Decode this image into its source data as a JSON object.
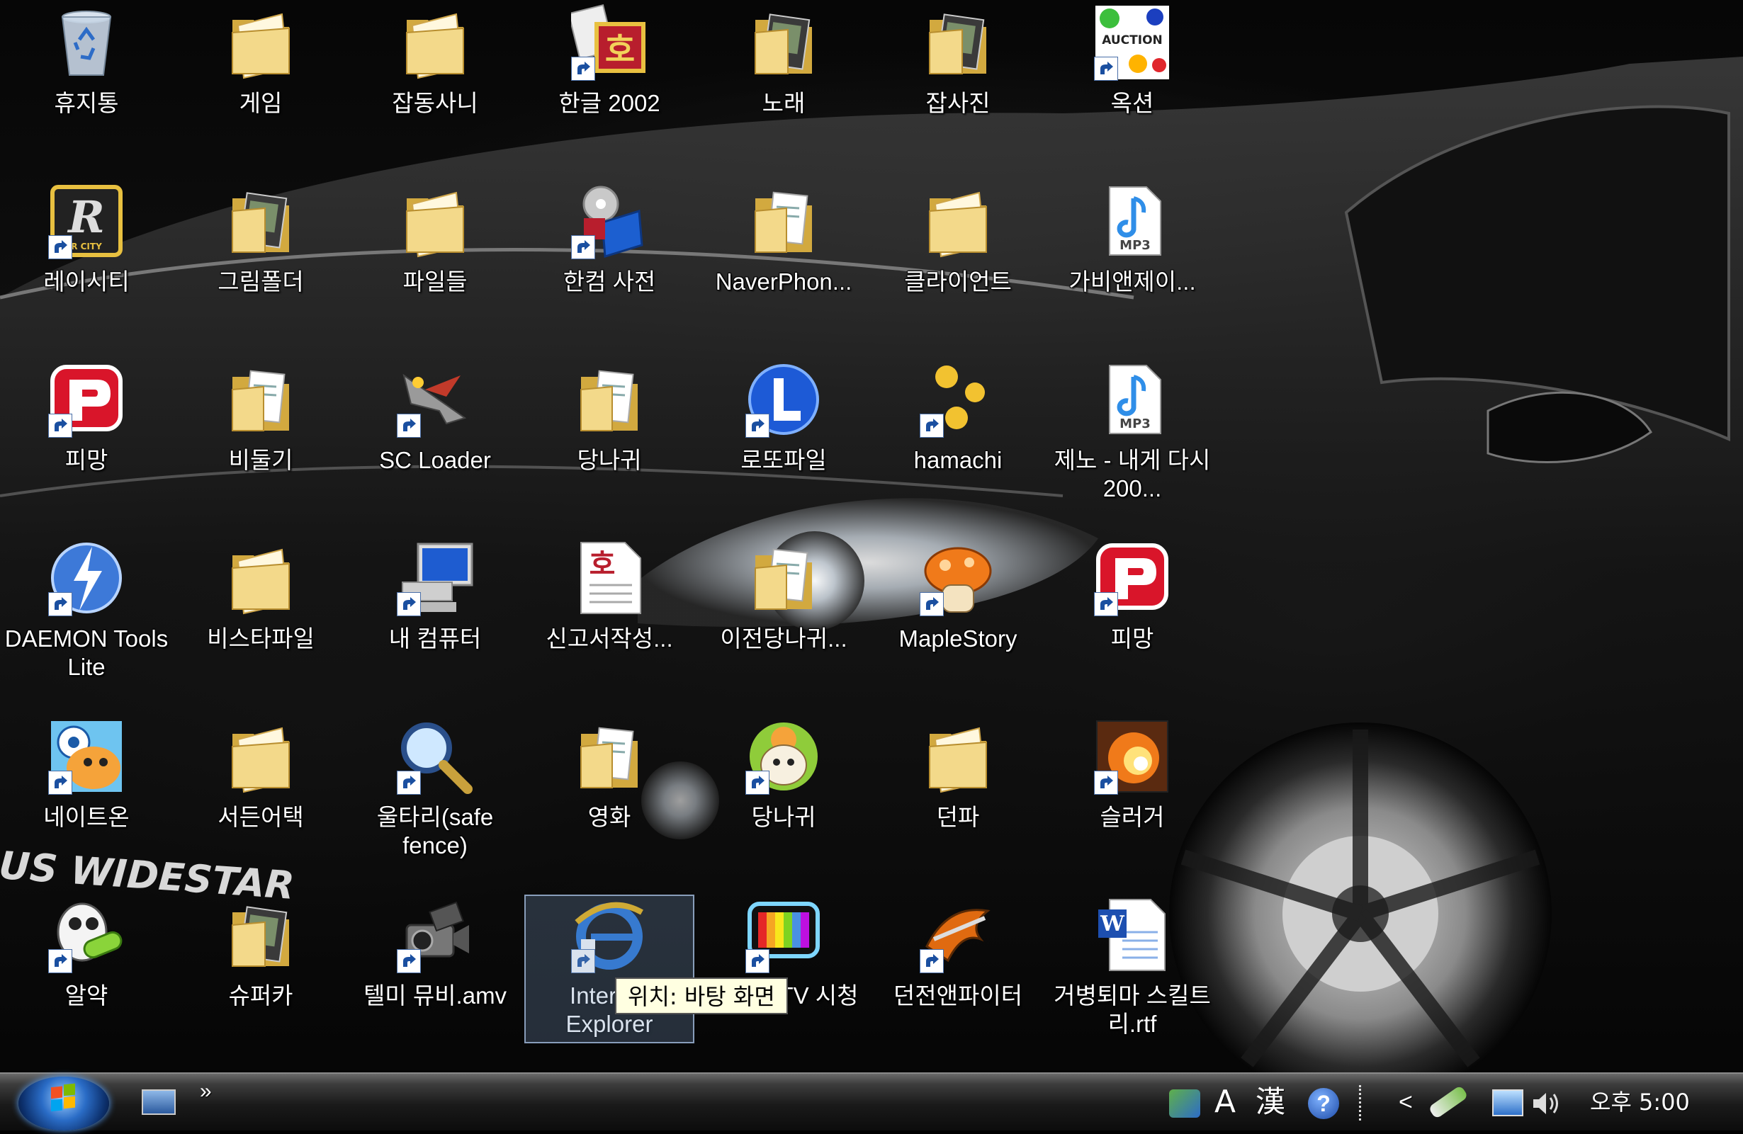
{
  "desktop": {
    "icons": [
      {
        "label": "휴지통",
        "kind": "recycle"
      },
      {
        "label": "게임",
        "kind": "folder"
      },
      {
        "label": "잡동사니",
        "kind": "folder"
      },
      {
        "label": "한글 2002",
        "kind": "hwp"
      },
      {
        "label": "노래",
        "kind": "folder-img"
      },
      {
        "label": "잡사진",
        "kind": "folder-img"
      },
      {
        "label": "옥션",
        "kind": "auction",
        "text": "AUCTION"
      },
      {
        "label": "레이시티",
        "kind": "racity",
        "text": "R CITY"
      },
      {
        "label": "그림폴더",
        "kind": "folder-img"
      },
      {
        "label": "파일들",
        "kind": "folder"
      },
      {
        "label": "한컴 사전",
        "kind": "dict"
      },
      {
        "label": "NaverPhon...",
        "kind": "folder-doc"
      },
      {
        "label": "클라이언트",
        "kind": "folder"
      },
      {
        "label": "가비앤제이...",
        "kind": "mp3",
        "text": "MP3"
      },
      {
        "label": "피망",
        "kind": "pmang"
      },
      {
        "label": "비둘기",
        "kind": "folder-doc"
      },
      {
        "label": "SC Loader",
        "kind": "ship"
      },
      {
        "label": "당나귀",
        "kind": "folder-doc"
      },
      {
        "label": "로또파일",
        "kind": "lotto"
      },
      {
        "label": "hamachi",
        "kind": "hamachi"
      },
      {
        "label": "제노 - 내게 다시 200...",
        "kind": "mp3",
        "text": "MP3"
      },
      {
        "label": "DAEMON Tools Lite",
        "kind": "daemon"
      },
      {
        "label": "비스타파일",
        "kind": "folder"
      },
      {
        "label": "내 컴퓨터",
        "kind": "computer"
      },
      {
        "label": "신고서작성...",
        "kind": "hwpdoc"
      },
      {
        "label": "이전당나귀...",
        "kind": "folder-doc"
      },
      {
        "label": "MapleStory",
        "kind": "maple"
      },
      {
        "label": "피망",
        "kind": "pmang"
      },
      {
        "label": "네이트온",
        "kind": "nate"
      },
      {
        "label": "서든어택",
        "kind": "folder"
      },
      {
        "label": "울타리(safe fence)",
        "kind": "magnifier"
      },
      {
        "label": "영화",
        "kind": "folder-doc"
      },
      {
        "label": "당나귀",
        "kind": "donkey"
      },
      {
        "label": "던파",
        "kind": "folder"
      },
      {
        "label": "슬러거",
        "kind": "slugger"
      },
      {
        "label": "알약",
        "kind": "alyac"
      },
      {
        "label": "슈퍼카",
        "kind": "folder-img"
      },
      {
        "label": "텔미 뮤비.amv",
        "kind": "camera"
      },
      {
        "label": "Internet Explorer",
        "kind": "ie"
      },
      {
        "label": "TV HDTV 시청",
        "kind": "tv"
      },
      {
        "label": "던전앤파이터",
        "kind": "dnf"
      },
      {
        "label": "거병퇴마 스킬트리.rtf",
        "kind": "word"
      }
    ],
    "wallpaper_text": "US WIDESTAR",
    "tooltip": "위치: 바탕 화면"
  },
  "taskbar": {
    "quicklaunch_more": "»",
    "ime_mode": "A",
    "ime_hanja": "漢",
    "help": "?",
    "chevron": "<",
    "clock": "오후 5:00"
  },
  "colors": {
    "folder": "#f3d98a",
    "folder_dark": "#d2a93f",
    "shortcut_arrow": "#1a4fa0",
    "taskbar": "#1a1a1a",
    "tooltip_bg": "#ffffe1"
  }
}
